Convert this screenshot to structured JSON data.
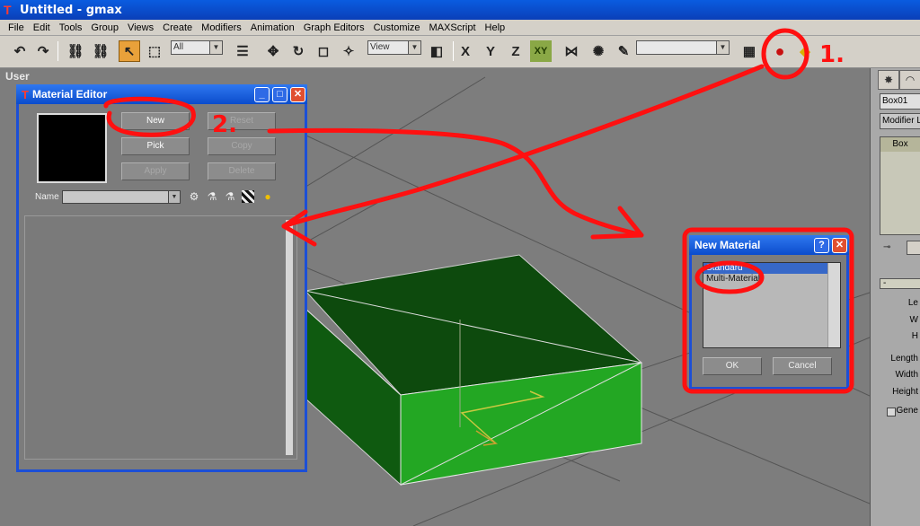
{
  "app": {
    "title": "Untitled - gmax"
  },
  "menu": [
    "File",
    "Edit",
    "Tools",
    "Group",
    "Views",
    "Create",
    "Modifiers",
    "Animation",
    "Graph Editors",
    "Customize",
    "MAXScript",
    "Help"
  ],
  "toolbar": {
    "selection_filter": "All",
    "ref_coord": "View",
    "named_selection": ""
  },
  "viewport": {
    "label": "User"
  },
  "command_panel": {
    "object_name": "Box01",
    "modifier_list": "Modifier Li",
    "stack_item": "Box",
    "rollout": "-",
    "params": [
      "Le",
      "W",
      "H",
      "Length",
      "Width",
      "Height",
      "Gene"
    ]
  },
  "material_editor": {
    "title": "Material Editor",
    "buttons": {
      "new": "New",
      "reset": "Reset",
      "pick": "Pick",
      "copy": "Copy",
      "apply": "Apply",
      "delete": "Delete"
    },
    "name_label": "Name",
    "name_value": ""
  },
  "new_material": {
    "title": "New Material",
    "items": [
      "Standard",
      "Multi-Material"
    ],
    "ok": "OK",
    "cancel": "Cancel"
  },
  "annotations": {
    "step1": "1.",
    "step2": "2."
  },
  "colors": {
    "box_top": "#0d4a0d",
    "box_front": "#23a723",
    "annotation": "#ff1010",
    "xp_blue": "#0b4ccc"
  }
}
